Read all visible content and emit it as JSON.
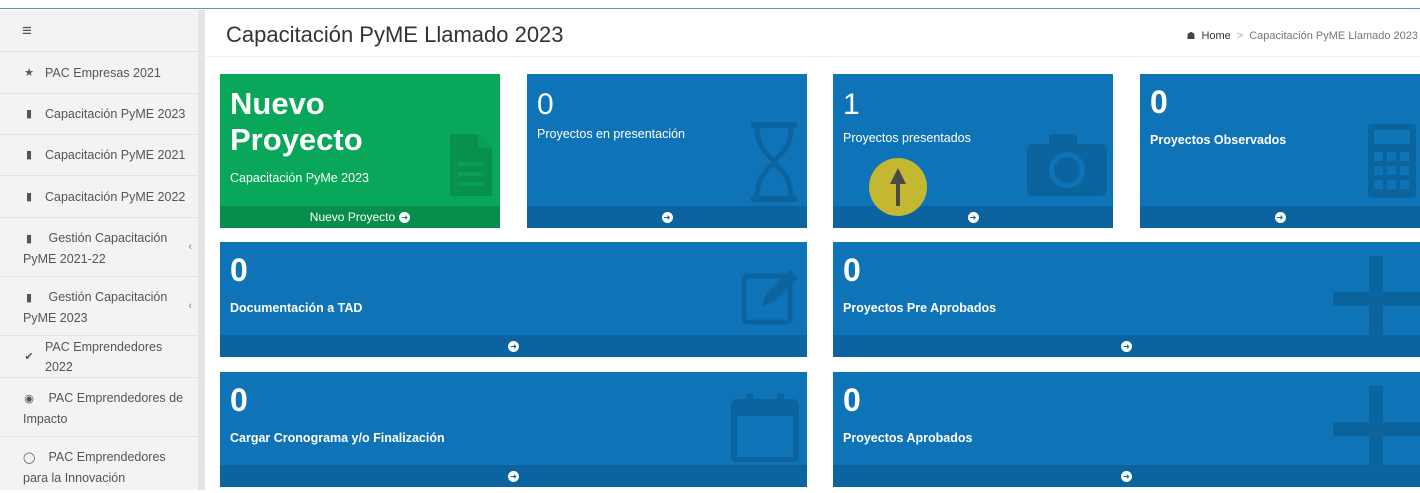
{
  "header": {
    "title": "Capacitación PyME Llamado 2023",
    "breadcrumb": {
      "home": "Home",
      "current": "Capacitación PyME Llamado 2023",
      "home_icon": "home-icon"
    }
  },
  "sidebar": {
    "toggle_icon": "hamburger-icon",
    "items": [
      {
        "label": "PAC Empresas 2021",
        "icon": "star-icon"
      },
      {
        "label": "Capacitación PyME 2023",
        "icon": "book-icon"
      },
      {
        "label": "Capacitación PyME 2021",
        "icon": "book-icon"
      },
      {
        "label": "Capacitación PyME 2022",
        "icon": "book-icon"
      },
      {
        "label": "Gestión Capacitación PyME 2021-22",
        "icon": "book-icon"
      },
      {
        "label": "Gestión Capacitación PyME 2023",
        "icon": "book-icon"
      },
      {
        "label": "PAC Emprendedores 2022",
        "icon": "check-circle-icon"
      },
      {
        "label": "PAC Emprendedores de Impacto",
        "icon": "eye-icon"
      },
      {
        "label": "PAC Emprendedores para la Innovación",
        "icon": "lightbulb-icon"
      }
    ]
  },
  "boxes": {
    "nuevo": {
      "title": "Nuevo Proyecto",
      "subtitle": "Capacitación PyMe 2023",
      "footer": "Nuevo Proyecto",
      "icon": "document-icon"
    },
    "presentacion": {
      "count": "0",
      "label": "Proyectos en presentación",
      "icon": "hourglass-icon"
    },
    "presentados": {
      "count": "1",
      "label": "Proyectos presentados",
      "icon": "camera-icon"
    },
    "observados": {
      "count": "0",
      "label": "Proyectos Observados",
      "icon": "calculator-icon"
    },
    "tad": {
      "count": "0",
      "label": "Documentación a TAD",
      "icon": "edit-icon"
    },
    "preaprobados": {
      "count": "0",
      "label": "Proyectos Pre Aprobados",
      "icon": "plus-icon"
    },
    "cronograma": {
      "count": "0",
      "label": "Cargar Cronograma y/o Finalización",
      "icon": "calendar-icon"
    },
    "aprobados": {
      "count": "0",
      "label": "Proyectos Aprobados",
      "icon": "plus-icon"
    }
  },
  "colors": {
    "blue": "#0f73b7",
    "blue_dark": "#0b63a0",
    "green": "#09a759",
    "cursor": "#c4b832"
  }
}
